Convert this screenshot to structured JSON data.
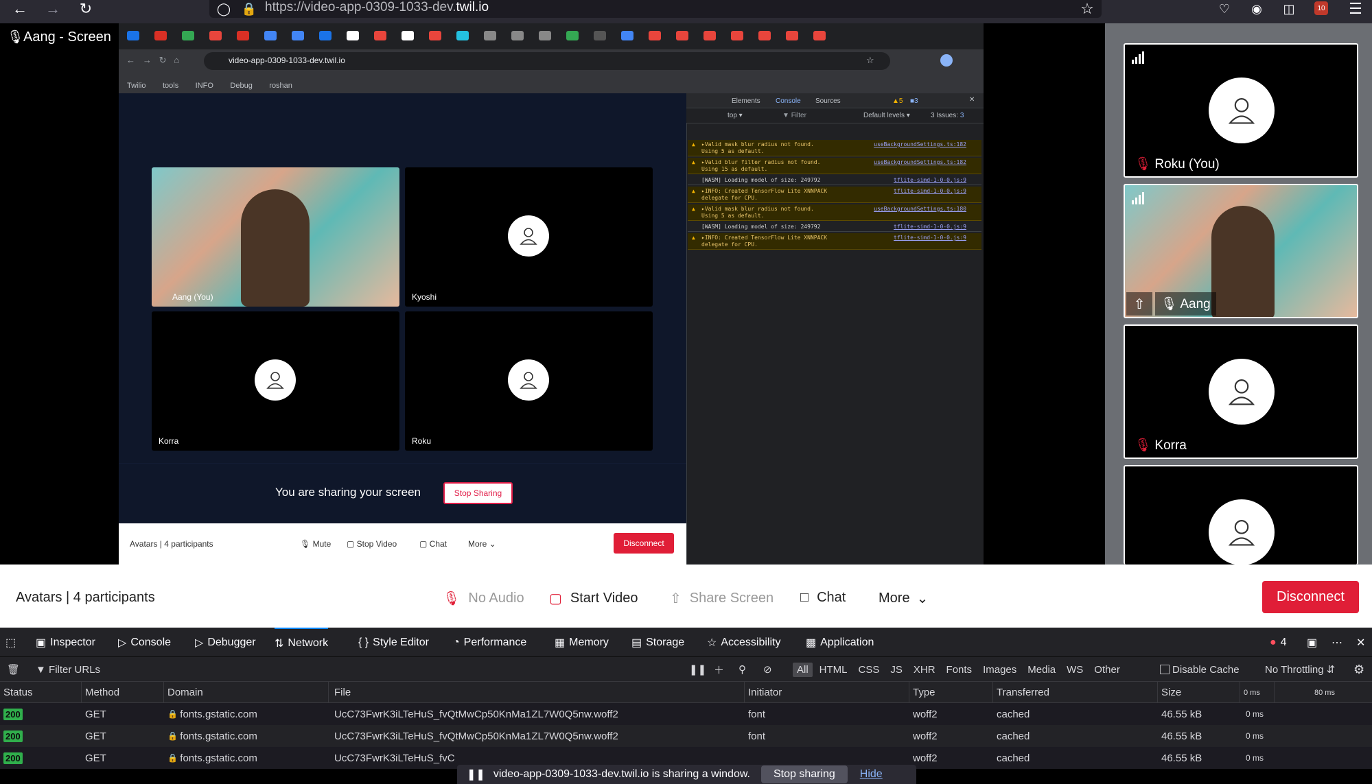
{
  "browser": {
    "url_prefix": "https://video-app-0309-1033-dev.",
    "url_domain": "twil.io",
    "badge_count": "10"
  },
  "share_window": {
    "label": "Aang - Screen"
  },
  "inner_chrome": {
    "url": "video-app-0309-1033-dev.twil.io",
    "bookmarks": [
      "Twilio",
      "tools",
      "INFO",
      "Debug",
      "roshan"
    ]
  },
  "inner_app": {
    "tiles": [
      {
        "name": "Aang (You)",
        "type": "video"
      },
      {
        "name": "Kyoshi",
        "type": "avatar"
      },
      {
        "name": "Korra",
        "type": "avatar"
      },
      {
        "name": "Roku",
        "type": "avatar"
      }
    ],
    "share_message": "You are sharing your screen",
    "stop_sharing": "Stop Sharing",
    "footer": {
      "room": "Avatars",
      "participants": "4 participants",
      "mute": "Mute",
      "stop_video": "Stop Video",
      "chat": "Chat",
      "more": "More",
      "disconnect": "Disconnect"
    }
  },
  "chrome_devtools": {
    "tabs": [
      "Elements",
      "Console",
      "Sources"
    ],
    "warn_count": "5",
    "info_count": "3",
    "context": "top",
    "filter_placeholder": "Filter",
    "levels": "Default levels",
    "issues_label": "3 Issues:",
    "issues_count": "3",
    "logs": [
      {
        "kind": "warn",
        "text": "▸Valid mask blur radius not found.\nUsing 5 as default.",
        "src": "useBackgroundSettings.ts:182"
      },
      {
        "kind": "warn",
        "text": "▸Valid blur filter radius not found.\nUsing 15 as default.",
        "src": "useBackgroundSettings.ts:182"
      },
      {
        "kind": "plain",
        "text": "[WASM] Loading model of size: 249792",
        "src": "tflite-simd-1-0-0.js:9"
      },
      {
        "kind": "warn",
        "text": "▸INFO: Created TensorFlow Lite XNNPACK\ndelegate for CPU.",
        "src": "tflite-simd-1-0-0.js:9"
      },
      {
        "kind": "warn",
        "text": "▸Valid mask blur radius not found.\nUsing 5 as default.",
        "src": "useBackgroundSettings.ts:180"
      },
      {
        "kind": "plain",
        "text": "[WASM] Loading model of size: 249792",
        "src": "tflite-simd-1-0-0.js:9"
      },
      {
        "kind": "warn",
        "text": "▸INFO: Created TensorFlow Lite XNNPACK\ndelegate for CPU.",
        "src": "tflite-simd-1-0-0.js:9"
      }
    ]
  },
  "right_panel": {
    "tiles": [
      {
        "name": "Roku (You)"
      },
      {
        "name": "Aang"
      },
      {
        "name": "Korra"
      },
      {
        "name": ""
      }
    ]
  },
  "controls": {
    "room": "Avatars",
    "participants": "4 participants",
    "no_audio": "No Audio",
    "start_video": "Start Video",
    "share_screen": "Share Screen",
    "chat": "Chat",
    "more": "More",
    "disconnect": "Disconnect"
  },
  "firefox_devtools": {
    "tabs": [
      "Inspector",
      "Console",
      "Debugger",
      "Network",
      "Style Editor",
      "Performance",
      "Memory",
      "Storage",
      "Accessibility",
      "Application"
    ],
    "active_tab": "Network",
    "error_count": "4",
    "filter_placeholder": "Filter URLs",
    "type_filters": [
      "All",
      "HTML",
      "CSS",
      "JS",
      "XHR",
      "Fonts",
      "Images",
      "Media",
      "WS",
      "Other"
    ],
    "disable_cache": "Disable Cache",
    "throttling": "No Throttling",
    "columns": [
      "Status",
      "Method",
      "Domain",
      "File",
      "Initiator",
      "Type",
      "Transferred",
      "Size"
    ],
    "timeline_ticks": [
      "0 ms",
      "80 ms"
    ],
    "rows": [
      {
        "status": "200",
        "method": "GET",
        "domain": "fonts.gstatic.com",
        "file": "UcC73FwrK3iLTeHuS_fvQtMwCp50KnMa1ZL7W0Q5nw.woff2",
        "initiator": "font",
        "type": "woff2",
        "transferred": "cached",
        "size": "46.55 kB",
        "time": "0 ms"
      },
      {
        "status": "200",
        "method": "GET",
        "domain": "fonts.gstatic.com",
        "file": "UcC73FwrK3iLTeHuS_fvQtMwCp50KnMa1ZL7W0Q5nw.woff2",
        "initiator": "font",
        "type": "woff2",
        "transferred": "cached",
        "size": "46.55 kB",
        "time": "0 ms"
      },
      {
        "status": "200",
        "method": "GET",
        "domain": "fonts.gstatic.com",
        "file": "UcC73FwrK3iLTeHuS_fvC",
        "initiator": "",
        "type": "woff2",
        "transferred": "cached",
        "size": "46.55 kB",
        "time": "0 ms"
      }
    ]
  },
  "share_notice": {
    "text": "video-app-0309-1033-dev.twil.io is sharing a window.",
    "stop": "Stop sharing",
    "hide": "Hide"
  }
}
